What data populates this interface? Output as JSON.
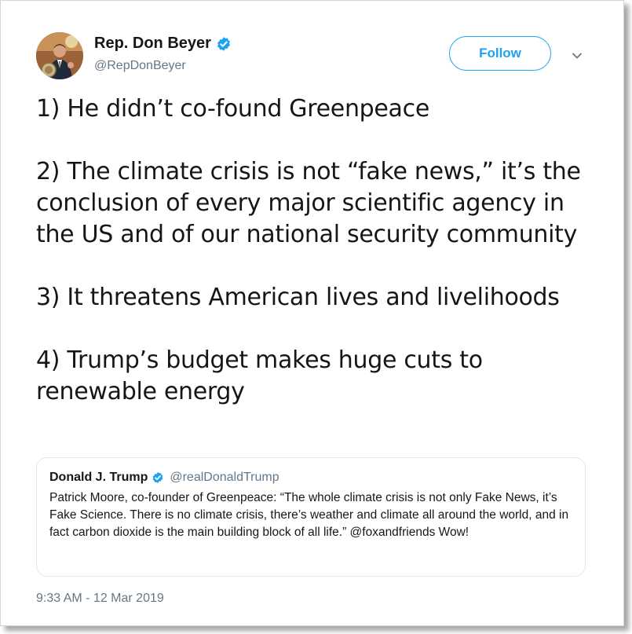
{
  "author": {
    "display_name": "Rep. Don Beyer",
    "handle": "@RepDonBeyer",
    "verified": true
  },
  "actions": {
    "follow_label": "Follow"
  },
  "tweet": {
    "paragraphs": [
      "1) He didn’t co-found Greenpeace",
      "2) The climate crisis is not “fake news,” it’s the conclusion of every major scientific agency in the US and of our national security community",
      "3) It threatens American lives and livelihoods",
      "4) Trump’s budget makes huge cuts to renewable energy"
    ],
    "timestamp": "9:33 AM - 12 Mar 2019"
  },
  "quoted_tweet": {
    "display_name": "Donald J. Trump",
    "handle": "@realDonaldTrump",
    "verified": true,
    "text": "Patrick Moore, co-founder of Greenpeace: “The whole climate crisis is not only Fake News, it’s Fake Science. There is no climate crisis, there’s weather and climate all around the world, and in fact carbon dioxide is the main building block of all life.” @foxandfriends  Wow!"
  },
  "colors": {
    "accent": "#1da1f2",
    "secondary_text": "#657786",
    "primary_text": "#14171a",
    "border": "#e1e8ed"
  },
  "icons": {
    "verified": "verified-badge-icon",
    "more": "chevron-down-icon"
  }
}
